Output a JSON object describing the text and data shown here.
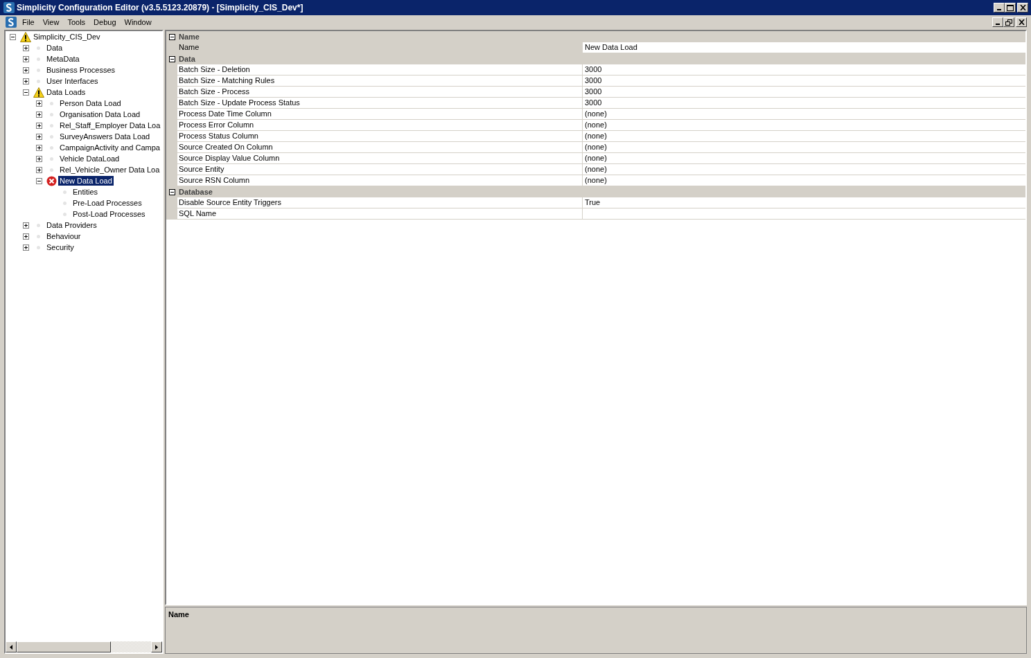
{
  "window": {
    "title": "Simplicity Configuration Editor (v3.5.5123.20879) - [Simplicity_CIS_Dev*]"
  },
  "menu": [
    "File",
    "View",
    "Tools",
    "Debug",
    "Window"
  ],
  "tree": [
    {
      "label": "Simplicity_CIS_Dev",
      "kind": "warning",
      "expanded": true,
      "selected": false,
      "children": [
        {
          "label": "Data",
          "kind": "dot",
          "expanded": false,
          "selected": false
        },
        {
          "label": "MetaData",
          "kind": "dot",
          "expanded": false,
          "selected": false
        },
        {
          "label": "Business Processes",
          "kind": "dot",
          "expanded": false,
          "selected": false
        },
        {
          "label": "User Interfaces",
          "kind": "dot",
          "expanded": false,
          "selected": false
        },
        {
          "label": "Data Loads",
          "kind": "warning",
          "expanded": true,
          "selected": false,
          "children": [
            {
              "label": "Person Data Load",
              "kind": "dot",
              "expanded": false,
              "selected": false
            },
            {
              "label": "Organisation Data Load",
              "kind": "dot",
              "expanded": false,
              "selected": false
            },
            {
              "label": "Rel_Staff_Employer Data Loa",
              "kind": "dot",
              "expanded": false,
              "selected": false
            },
            {
              "label": "SurveyAnswers Data Load",
              "kind": "dot",
              "expanded": false,
              "selected": false
            },
            {
              "label": "CampaignActivity and Campa",
              "kind": "dot",
              "expanded": false,
              "selected": false
            },
            {
              "label": "Vehicle DataLoad",
              "kind": "dot",
              "expanded": false,
              "selected": false
            },
            {
              "label": "Rel_Vehicle_Owner Data Loa",
              "kind": "dot",
              "expanded": false,
              "selected": false
            },
            {
              "label": "New Data Load",
              "kind": "error",
              "expanded": true,
              "selected": true,
              "children": [
                {
                  "label": "Entities",
                  "kind": "dot",
                  "selected": false
                },
                {
                  "label": "Pre-Load Processes",
                  "kind": "dot",
                  "selected": false
                },
                {
                  "label": "Post-Load Processes",
                  "kind": "dot",
                  "selected": false
                }
              ]
            }
          ]
        },
        {
          "label": "Data Providers",
          "kind": "dot",
          "expanded": false,
          "selected": false
        },
        {
          "label": "Behaviour",
          "kind": "dot",
          "expanded": false,
          "selected": false
        },
        {
          "label": "Security",
          "kind": "dot",
          "expanded": false,
          "selected": false
        }
      ]
    }
  ],
  "properties": [
    {
      "category": "Name",
      "expanded": true,
      "rows": [
        {
          "name": "Name",
          "value": "New Data Load",
          "selected": true
        }
      ]
    },
    {
      "category": "Data",
      "expanded": true,
      "rows": [
        {
          "name": "Batch Size - Deletion",
          "value": "3000",
          "selected": false
        },
        {
          "name": "Batch Size - Matching Rules",
          "value": "3000",
          "selected": false
        },
        {
          "name": "Batch Size - Process",
          "value": "3000",
          "selected": false
        },
        {
          "name": "Batch Size - Update Process Status",
          "value": "3000",
          "selected": false
        },
        {
          "name": "Process Date Time Column",
          "value": "(none)",
          "selected": false
        },
        {
          "name": "Process Error Column",
          "value": "(none)",
          "selected": false
        },
        {
          "name": "Process Status Column",
          "value": "(none)",
          "selected": false
        },
        {
          "name": "Source Created On Column",
          "value": "(none)",
          "selected": false
        },
        {
          "name": "Source Display Value Column",
          "value": "(none)",
          "selected": false
        },
        {
          "name": "Source Entity",
          "value": "(none)",
          "selected": false
        },
        {
          "name": "Source RSN Column",
          "value": "(none)",
          "selected": false
        }
      ]
    },
    {
      "category": "Database",
      "expanded": true,
      "rows": [
        {
          "name": "Disable Source Entity Triggers",
          "value": "True",
          "selected": false
        },
        {
          "name": "SQL Name",
          "selected": false
        }
      ]
    }
  ],
  "description": {
    "title": "Name"
  }
}
